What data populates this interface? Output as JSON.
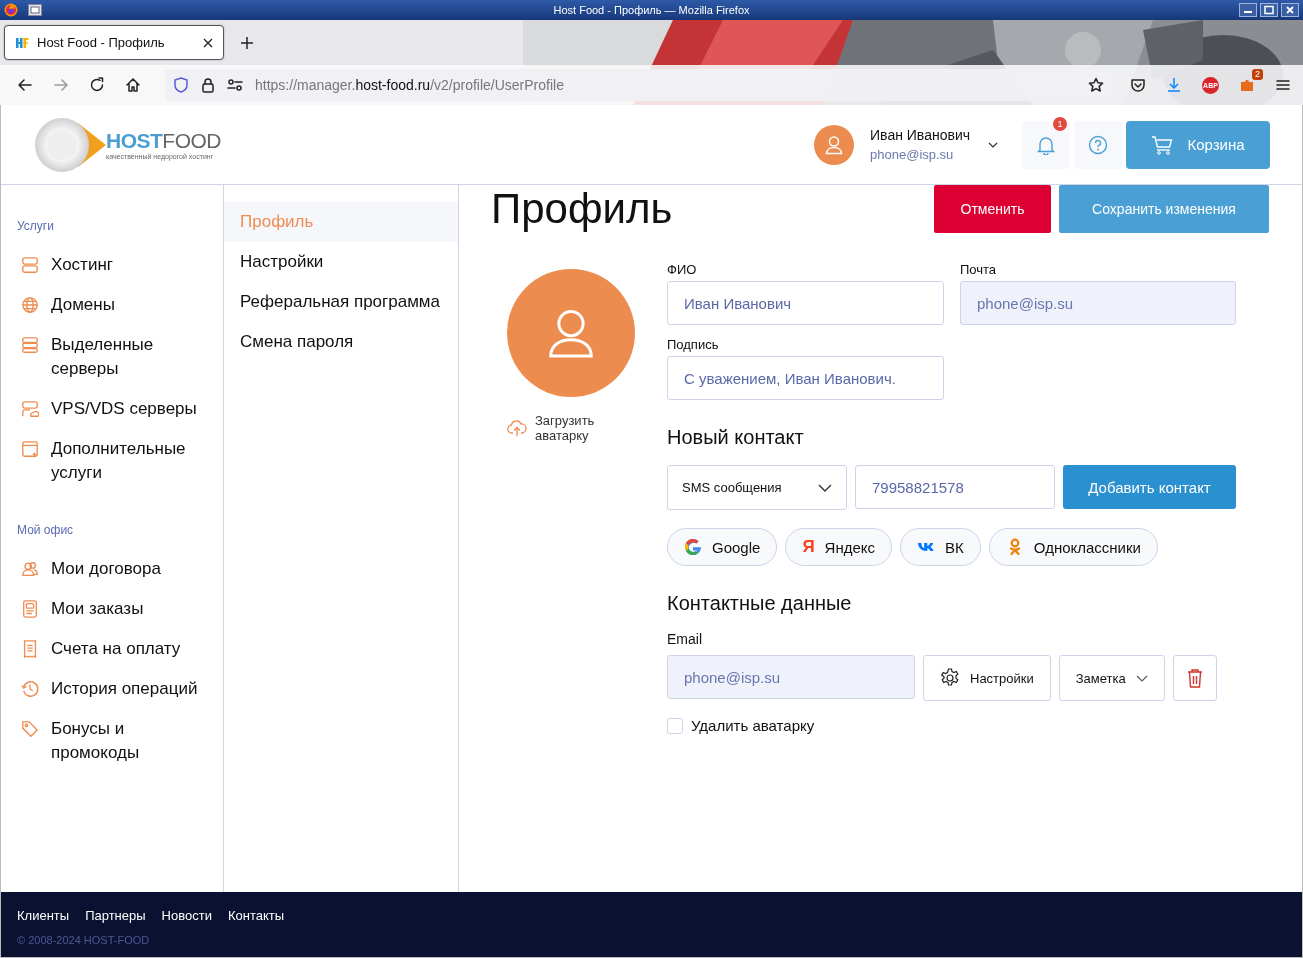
{
  "window": {
    "title": "Host Food - Профиль — Mozilla Firefox"
  },
  "browser": {
    "tabs": [
      {
        "title": "Host Food - Профиль",
        "selected": true
      }
    ],
    "url": {
      "prefix": "https://manager.",
      "domain": "host-food.ru",
      "path": "/v2/profile/UserProfile"
    },
    "extensions": [
      {
        "kind": "abp",
        "label": "ABP"
      },
      {
        "kind": "puzzle",
        "badge": "2"
      }
    ]
  },
  "header": {
    "logo": {
      "part1": "HOST",
      "part2": "FOOD",
      "tagline": "качественный недорогой хостинг"
    },
    "user": {
      "name": "Иван Иванович",
      "email": "phone@isp.su"
    },
    "notifications": {
      "count": "1"
    },
    "cart": "Корзина"
  },
  "sidebar": {
    "sections": [
      {
        "title": "Услуги",
        "items": [
          {
            "kind": "server",
            "label": "Хостинг"
          },
          {
            "kind": "globe",
            "label": "Домены"
          },
          {
            "kind": "rack",
            "label": "Выделенные серверы"
          },
          {
            "kind": "cloud",
            "label": "VPS/VDS серверы"
          },
          {
            "kind": "window",
            "label": "Дополнительные услуги"
          }
        ]
      },
      {
        "title": "Мой офис",
        "items": [
          {
            "kind": "people",
            "label": "Мои договора"
          },
          {
            "kind": "orders",
            "label": "Мои заказы"
          },
          {
            "kind": "receipt",
            "label": "Счета на оплату"
          },
          {
            "kind": "history",
            "label": "История операций"
          },
          {
            "kind": "tag",
            "label": "Бонусы и промокоды"
          }
        ]
      }
    ]
  },
  "subnav": [
    {
      "label": "Профиль",
      "selected": true
    },
    {
      "label": "Настройки",
      "selected": false
    },
    {
      "label": "Реферальная программа",
      "selected": false
    },
    {
      "label": "Смена пароля",
      "selected": false
    }
  ],
  "page": {
    "title": "Профиль",
    "cancel": "Отменить",
    "save": "Сохранить изменения"
  },
  "avatar": {
    "upload": "Загрузить аватарку"
  },
  "fields": [
    {
      "label": "ФИО",
      "value": "Иван Иванович",
      "disabled": false
    },
    {
      "label": "Почта",
      "value": "phone@isp.su",
      "disabled": true
    },
    {
      "label": "Подпись",
      "value": "С уважением, Иван Иванович.",
      "disabled": false
    }
  ],
  "new_contact": {
    "title": "Новый контакт",
    "type": "SMS сообщения",
    "number": "79958821578",
    "add": "Добавить контакт"
  },
  "social": [
    {
      "kind": "google",
      "label": "Google"
    },
    {
      "kind": "yandex",
      "icon": "Я",
      "label": "Яндекс"
    },
    {
      "kind": "vk",
      "label": "ВК"
    },
    {
      "kind": "ok",
      "label": "Одноклассники"
    }
  ],
  "contacts": {
    "title": "Контактные данные",
    "items": [
      {
        "label": "Email",
        "value": "phone@isp.su",
        "disabled": true,
        "settings": "Настройки",
        "note": "Заметка"
      }
    ]
  },
  "delete_avatar": {
    "label": "Удалить аватарку",
    "checked": false
  },
  "footer": {
    "links": [
      "Клиенты",
      "Партнеры",
      "Новости",
      "Контакты"
    ],
    "copyright": "© 2008-2024 HOST-FOOD"
  }
}
